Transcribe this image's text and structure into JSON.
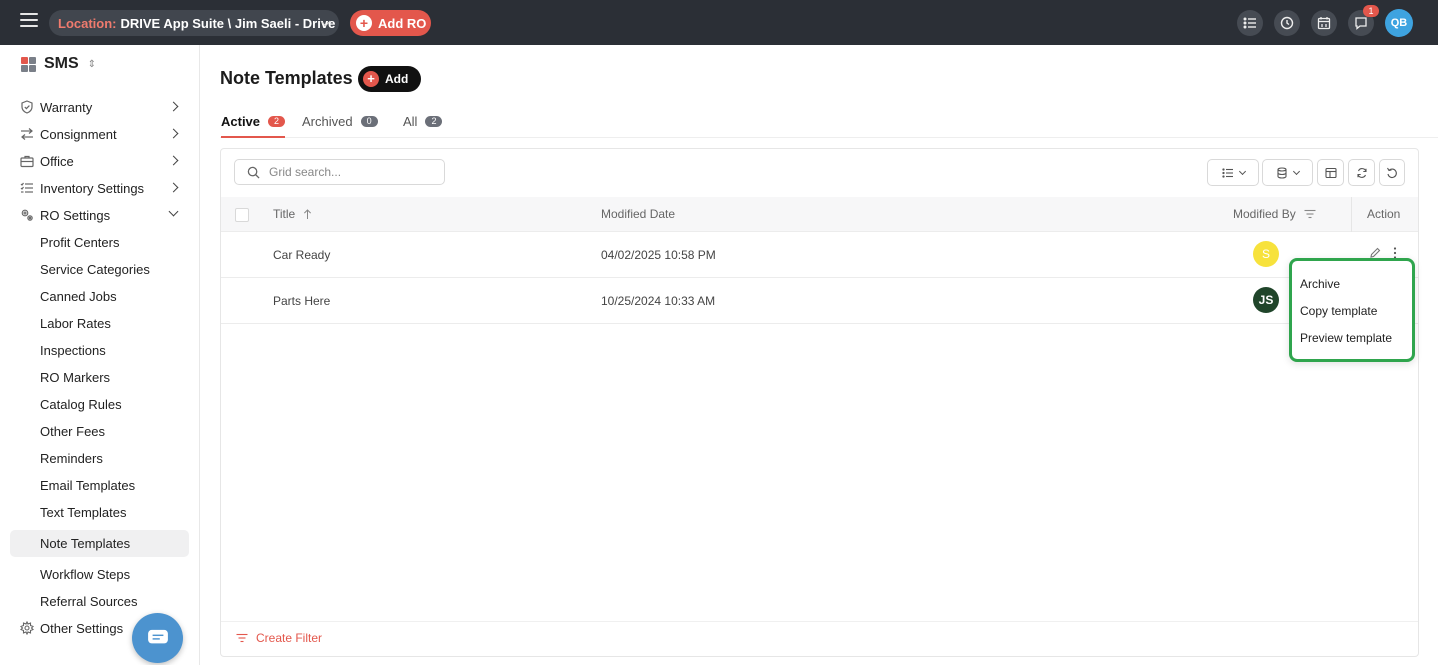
{
  "topbar": {
    "location_label": "Location:",
    "location_value": "DRIVE App Suite \\ Jim Saeli - Drive",
    "add_ro_label": "Add RO",
    "notification_count": "1",
    "user_initials": "QB"
  },
  "sidebar": {
    "app_name": "SMS",
    "sections": [
      {
        "label": "Warranty",
        "icon": "shield-icon"
      },
      {
        "label": "Consignment",
        "icon": "swap-arrows-icon"
      },
      {
        "label": "Office",
        "icon": "briefcase-icon"
      },
      {
        "label": "Inventory Settings",
        "icon": "checklist-icon"
      },
      {
        "label": "RO Settings",
        "icon": "gears-icon"
      }
    ],
    "ro_settings_items": [
      "Profit Centers",
      "Service Categories",
      "Canned Jobs",
      "Labor Rates",
      "Inspections",
      "RO Markers",
      "Catalog Rules",
      "Other Fees",
      "Reminders",
      "Email Templates",
      "Text Templates",
      "Note Templates",
      "Workflow Steps",
      "Referral Sources"
    ],
    "other_settings_label": "Other Settings",
    "active_item": "Note Templates"
  },
  "page": {
    "title": "Note Templates",
    "add_label": "Add"
  },
  "tabs": [
    {
      "label": "Active",
      "count": "2",
      "active": true
    },
    {
      "label": "Archived",
      "count": "0",
      "active": false
    },
    {
      "label": "All",
      "count": "2",
      "active": false
    }
  ],
  "grid": {
    "search_placeholder": "Grid search...",
    "columns": {
      "title": "Title",
      "modified_date": "Modified Date",
      "modified_by": "Modified By",
      "action": "Action"
    },
    "rows": [
      {
        "title": "Car Ready",
        "modified_date": "04/02/2025 10:58 PM",
        "modified_by_initials": "S",
        "avatar_color": "#f7e23c"
      },
      {
        "title": "Parts Here",
        "modified_date": "10/25/2024 10:33 AM",
        "modified_by_initials": "JS",
        "avatar_color": "#20452a"
      }
    ],
    "create_filter_label": "Create Filter"
  },
  "row_menu": {
    "items": [
      "Archive",
      "Copy template",
      "Preview template"
    ]
  },
  "colors": {
    "accent": "#e3574c",
    "topbar": "#2b2f36",
    "menu_highlight": "#2fa54d",
    "brand_tiles": [
      "#e3574c",
      "#7a7f88",
      "#7a7f88",
      "#7a7f88"
    ]
  }
}
